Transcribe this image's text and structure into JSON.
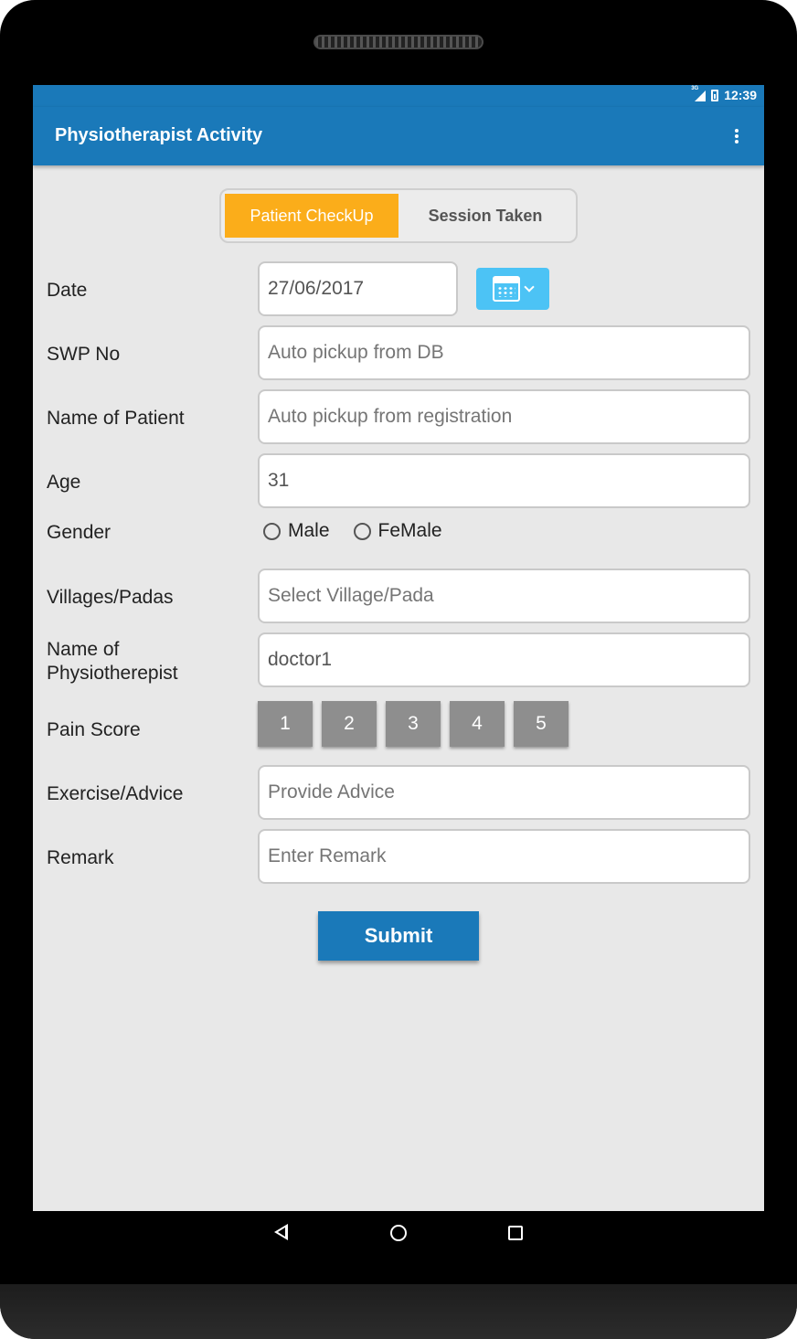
{
  "status_bar": {
    "network": "3G",
    "time": "12:39"
  },
  "app_bar": {
    "title": "Physiotherapist Activity",
    "menu_icon": "more-vert-icon"
  },
  "tabs": [
    {
      "label": "Patient CheckUp",
      "active": true,
      "color": "#fbad1a"
    },
    {
      "label": "Session Taken",
      "active": false
    }
  ],
  "form": {
    "date": {
      "label": "Date",
      "value": "27/06/2017",
      "picker_icon": "calendar-icon"
    },
    "swp_no": {
      "label": "SWP No",
      "placeholder": "Auto pickup from DB"
    },
    "patient_name": {
      "label": "Name of Patient",
      "placeholder": "Auto pickup from registration"
    },
    "age": {
      "label": "Age",
      "value": "31"
    },
    "gender": {
      "label": "Gender",
      "options": [
        "Male",
        "FeMale"
      ]
    },
    "village": {
      "label": "Villages/Padas",
      "placeholder": "Select Village/Pada"
    },
    "physiotherapist": {
      "label_line1": "Name of",
      "label_line2": "Physiotherepist",
      "value": "doctor1"
    },
    "pain_score": {
      "label": "Pain Score",
      "options": [
        "1",
        "2",
        "3",
        "4",
        "5"
      ]
    },
    "exercise": {
      "label": "Exercise/Advice",
      "placeholder": "Provide Advice"
    },
    "remark": {
      "label": "Remark",
      "placeholder": "Enter Remark"
    }
  },
  "submit_label": "Submit",
  "colors": {
    "primary": "#1a79b9",
    "accent": "#fbad1a",
    "calendar_button": "#4cc3f5",
    "pain_button": "#8e8e8e"
  },
  "nav": {
    "back_icon": "back-icon",
    "home_icon": "home-icon",
    "recent_icon": "recents-icon"
  }
}
